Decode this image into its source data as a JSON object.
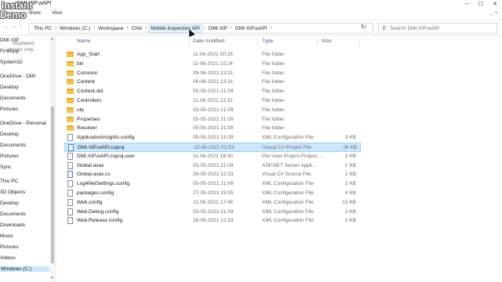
{
  "window": {
    "title": "DMI.XIP.wAPI"
  },
  "ribbon": {
    "tabs": [
      "Share",
      "View"
    ]
  },
  "address": {
    "crumbs": [
      "This PC",
      "Windows (C:)",
      "Workspace",
      "CNA",
      "Mobile Inspection API",
      "DMI.XIP",
      "DMI.XIP.wAPI"
    ],
    "search_placeholder": "Search DMI.XIP.wAPI"
  },
  "nav": {
    "items": [
      "DMI.XIP",
      "FirstApp",
      "System32",
      "OneDrive - DMI",
      "Desktop",
      "Documents",
      "Pictures",
      "OneDrive - Personal",
      "Desktop",
      "Documents",
      "Pictures",
      "Sync",
      "This PC",
      "3D Objects",
      "Desktop",
      "Documents",
      "Downloads",
      "Music",
      "Pictures",
      "Videos",
      "Windows (C:)"
    ],
    "selected": "Windows (C:)"
  },
  "columns": {
    "name": "Name",
    "date": "Date modified",
    "type": "Type",
    "size": "Size"
  },
  "files": [
    {
      "name": "App_Start",
      "date": "11-06-2021 00:25",
      "type": "File folder",
      "size": "",
      "icon": "folder-icon"
    },
    {
      "name": "bin",
      "date": "11-06-2021 22:24",
      "type": "File folder",
      "size": "",
      "icon": "folder-icon"
    },
    {
      "name": "Common",
      "date": "09-06-2021 13:31",
      "type": "File folder",
      "size": "",
      "icon": "folder-icon"
    },
    {
      "name": "Content",
      "date": "09-06-2021 13:31",
      "type": "File folder",
      "size": "",
      "icon": "folder-icon"
    },
    {
      "name": "Content.old",
      "date": "05-05-2021 21:09",
      "type": "File folder",
      "size": "",
      "icon": "folder-icon"
    },
    {
      "name": "Controllers",
      "date": "11-06-2021 12:31",
      "type": "File folder",
      "size": "",
      "icon": "folder-icon"
    },
    {
      "name": "obj",
      "date": "05-05-2021 21:09",
      "type": "File folder",
      "size": "",
      "icon": "folder-icon"
    },
    {
      "name": "Properties",
      "date": "05-05-2021 21:09",
      "type": "File folder",
      "size": "",
      "icon": "folder-icon"
    },
    {
      "name": "Resolver",
      "date": "05-05-2021 21:09",
      "type": "File folder",
      "size": "",
      "icon": "folder-icon"
    },
    {
      "name": "ApplicationInsights.config",
      "date": "05-05-2021 21:09",
      "type": "XML Configuration File",
      "size": "3 KB",
      "icon": "config-file-icon"
    },
    {
      "name": "DMI.XIP.wAPI.csproj",
      "date": "12-06-2021 01:53",
      "type": "Visual C# Project File",
      "size": "36 KB",
      "icon": "csproj-file-icon"
    },
    {
      "name": "DMI.XIP.wAPI.csproj.user",
      "date": "11-06-2021 18:30",
      "type": "Per-User Project Project...",
      "size": "2 KB",
      "icon": "file-icon"
    },
    {
      "name": "Global.asax",
      "date": "05-05-2021 21:09",
      "type": "ASP.NET Server Appli...",
      "size": "1 KB",
      "icon": "file-icon"
    },
    {
      "name": "Global.asax.cs",
      "date": "26-05-2021 12:33",
      "type": "Visual C# Source File",
      "size": "1 KB",
      "icon": "cs-file-icon"
    },
    {
      "name": "Log4NetSettings.config",
      "date": "05-05-2021 21:09",
      "type": "XML Configuration File",
      "size": "2 KB",
      "icon": "config-file-icon"
    },
    {
      "name": "packages.config",
      "date": "27-05-2021 15:05",
      "type": "XML Configuration File",
      "size": "6 KB",
      "icon": "config-file-icon"
    },
    {
      "name": "Web.config",
      "date": "11-06-2021 17:48",
      "type": "XML Configuration File",
      "size": "12 KB",
      "icon": "config-file-icon"
    },
    {
      "name": "Web.Debug.config",
      "date": "05-05-2021 21:09",
      "type": "XML Configuration File",
      "size": "2 KB",
      "icon": "config-file-icon"
    },
    {
      "name": "Web.Release.config",
      "date": "26-05-2021 12:33",
      "type": "XML Configuration File",
      "size": "2 KB",
      "icon": "config-file-icon"
    }
  ],
  "selected_file": "DMI.XIP.wAPI.csproj",
  "watermark": {
    "line1": "Instant",
    "line2": "Demo",
    "line3": "displayed",
    "line4": "version only"
  },
  "colors": {
    "selection": "#cce8ff",
    "selection_border": "#99d1ff",
    "folder": "#f3c34f",
    "header_text": "#4d6082"
  }
}
